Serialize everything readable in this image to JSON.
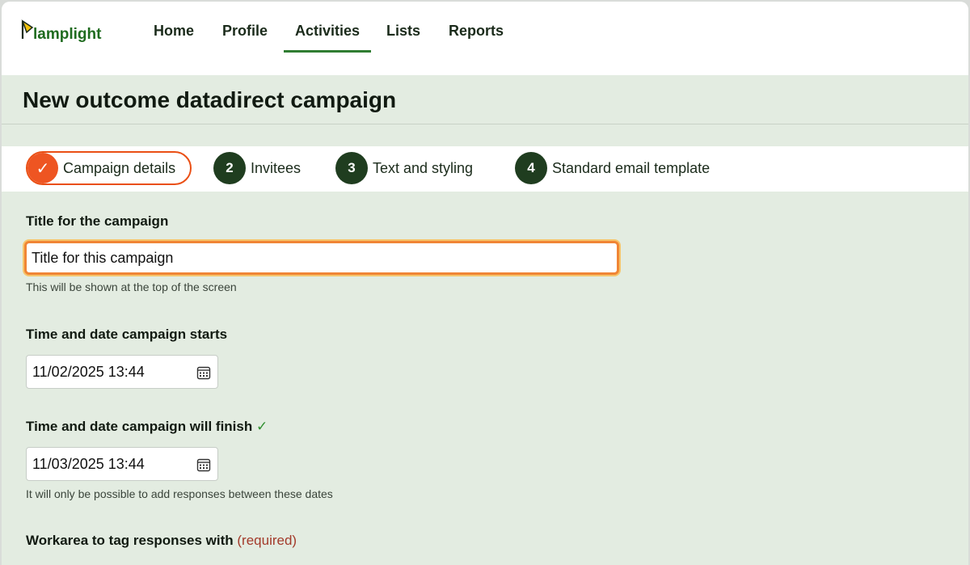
{
  "brand": {
    "name": "lamplight"
  },
  "nav": {
    "items": [
      {
        "label": "Home"
      },
      {
        "label": "Profile"
      },
      {
        "label": "Activities",
        "active": true
      },
      {
        "label": "Lists"
      },
      {
        "label": "Reports"
      }
    ]
  },
  "page": {
    "title": "New outcome datadirect campaign"
  },
  "steps": [
    {
      "marker": "✓",
      "label": "Campaign details",
      "state": "current-complete"
    },
    {
      "marker": "2",
      "label": "Invitees"
    },
    {
      "marker": "3",
      "label": "Text and styling"
    },
    {
      "marker": "4",
      "label": "Standard email template"
    }
  ],
  "form": {
    "title_field": {
      "label": "Title for the campaign",
      "value": "Title for this campaign",
      "hint": "This will be shown at the top of the screen"
    },
    "start_field": {
      "label": "Time and date campaign starts",
      "value": "11/02/2025 13:44",
      "icon": "calendar-icon"
    },
    "finish_field": {
      "label": "Time and date campaign will finish",
      "valid_mark": "✓",
      "value": "11/03/2025 13:44",
      "icon": "calendar-icon",
      "hint": "It will only be possible to add responses between these dates"
    },
    "workarea_field": {
      "label": "Workarea to tag responses with",
      "required_note": "(required)"
    }
  },
  "colors": {
    "accent_green": "#2f7d32",
    "step_orange": "#ea4f14",
    "step_dark": "#1f3d1f",
    "page_bg": "#e3ece1",
    "focus_orange": "#f08535"
  }
}
